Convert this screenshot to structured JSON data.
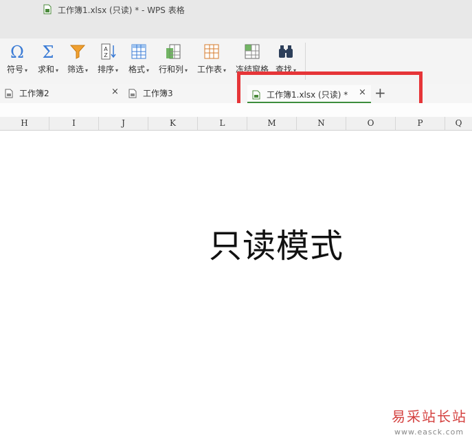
{
  "window": {
    "title": "工作簿1.xlsx (只读) * - WPS 表格",
    "icon": "spreadsheet-file-icon"
  },
  "ribbon": {
    "items": [
      {
        "label": "符号",
        "icon": "omega-icon",
        "has_dropdown": true
      },
      {
        "label": "求和",
        "icon": "sigma-icon",
        "has_dropdown": true
      },
      {
        "label": "筛选",
        "icon": "funnel-filter-icon",
        "has_dropdown": true
      },
      {
        "label": "排序",
        "icon": "sort-az-icon",
        "has_dropdown": true
      },
      {
        "label": "格式",
        "icon": "format-table-icon",
        "has_dropdown": true
      },
      {
        "label": "行和列",
        "icon": "rows-columns-icon",
        "has_dropdown": true
      },
      {
        "label": "工作表",
        "icon": "worksheet-icon",
        "has_dropdown": true
      },
      {
        "label": "冻结窗格",
        "icon": "freeze-panes-icon",
        "has_dropdown": false
      },
      {
        "label": "查找",
        "icon": "binoculars-icon",
        "has_dropdown": true
      }
    ],
    "caret": "▾"
  },
  "tabs": [
    {
      "label": "工作簿2",
      "icon": "spreadsheet-file-icon",
      "active": false
    },
    {
      "label": "工作簿3",
      "icon": "spreadsheet-file-icon",
      "active": false
    },
    {
      "label": "工作簿1.xlsx (只读) *",
      "icon": "spreadsheet-file-icon",
      "active": true
    }
  ],
  "tab_close_glyph": "×",
  "tab_add_glyph": "+",
  "columns": [
    "H",
    "I",
    "J",
    "K",
    "L",
    "M",
    "N",
    "O",
    "P",
    "Q"
  ],
  "overlay_text": "只读模式",
  "watermark": {
    "text": "易采站长站",
    "url_text": "www.easck.com"
  },
  "colors": {
    "highlight_border": "#e63538",
    "active_tab_underline": "#3c8d3c",
    "watermark": "#d4413f"
  }
}
